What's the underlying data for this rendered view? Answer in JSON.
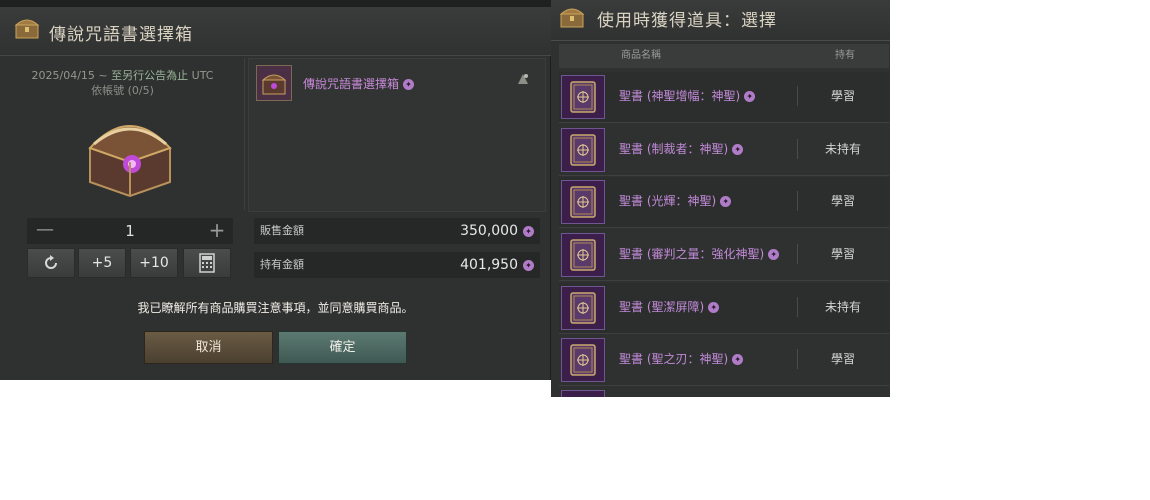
{
  "left_panel": {
    "title": "傳說咒語書選擇箱",
    "date_prefix": "2025/04/15 ~ ",
    "date_accent": "至另行公告為止",
    "date_suffix": " UTC",
    "purchase_count": "依帳號 (0/5)",
    "item_name": "傳說咒語書選擇箱",
    "quantity": "1",
    "quick_buttons": [
      "+5",
      "+10"
    ],
    "sale_price_label": "販售金額",
    "sale_price_value": "350,000",
    "owned_label": "持有金額",
    "owned_value": "401,950",
    "agreement_text": "我已瞭解所有商品購買注意事項，並同意購買商品。",
    "cancel_label": "取消",
    "confirm_label": "確定"
  },
  "right_panel": {
    "title": "使用時獲得道具：選擇",
    "col_name": "商品名稱",
    "col_owned": "持有",
    "items": [
      {
        "name": "聖書 (神聖增幅：神聖)",
        "status": "學習"
      },
      {
        "name": "聖書 (制裁者：神聖)",
        "status": "未持有"
      },
      {
        "name": "聖書 (光輝：神聖)",
        "status": "學習"
      },
      {
        "name": "聖書 (審判之量：強化神聖)",
        "status": "學習"
      },
      {
        "name": "聖書 (聖潔屏障)",
        "status": "未持有"
      },
      {
        "name": "聖書 (聖之刃：神聖)",
        "status": "學習"
      }
    ]
  },
  "colors": {
    "panel_bg": "#2f3030",
    "item_purple": "#c58ad6",
    "cancel_brown": "#5b4c38",
    "confirm_teal": "#4d6962"
  },
  "icons": [
    "chest-header-icon",
    "chest-icon",
    "coin-icon",
    "refresh-icon",
    "calculator-icon",
    "book-icon",
    "share-icon"
  ]
}
